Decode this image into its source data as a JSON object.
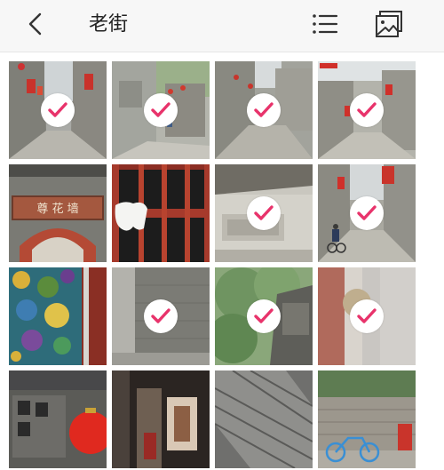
{
  "header": {
    "title": "老街",
    "back_icon": "chevron-left-icon",
    "list_icon": "list-icon",
    "gallery_icon": "photo-gallery-icon"
  },
  "colors": {
    "check_accent": "#e8336b",
    "header_bg": "#f7f7f7"
  },
  "grid": {
    "columns": 4,
    "photos": [
      {
        "subject": "alley-with-red-banners",
        "selected": true
      },
      {
        "subject": "old-building-with-lanterns",
        "selected": true
      },
      {
        "subject": "street-corner",
        "selected": true
      },
      {
        "subject": "street-with-red-flags",
        "selected": true
      },
      {
        "subject": "archway-with-sign",
        "selected": false,
        "sign_text": "尊 花 墙"
      },
      {
        "subject": "wooden-window-lattice",
        "selected": false
      },
      {
        "subject": "whitewashed-wall-gate",
        "selected": true
      },
      {
        "subject": "cyclist-in-lane",
        "selected": true
      },
      {
        "subject": "stained-glass-window",
        "selected": false
      },
      {
        "subject": "grey-brick-wall",
        "selected": true
      },
      {
        "subject": "tree-and-eave",
        "selected": true
      },
      {
        "subject": "blurry-wall-and-lamp",
        "selected": true
      },
      {
        "subject": "carved-sign-red-lantern",
        "selected": false
      },
      {
        "subject": "dark-alley-doorway",
        "selected": false
      },
      {
        "subject": "textured-metal-mesh",
        "selected": false
      },
      {
        "subject": "bicycle-by-brick-wall",
        "selected": false
      }
    ]
  }
}
